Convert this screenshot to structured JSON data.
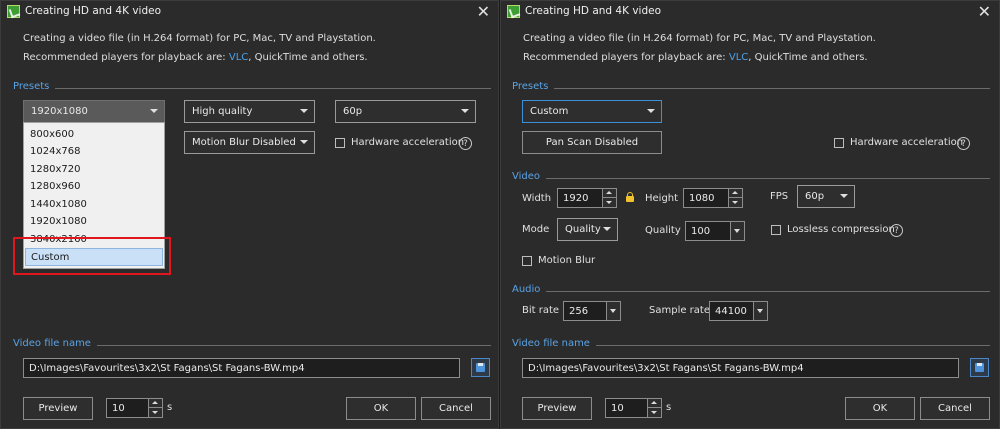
{
  "dialog": {
    "title": "Creating HD and 4K video",
    "desc_line1": "Creating a video file (in H.264 format) for PC, Mac, TV and Playstation.",
    "desc_line2_prefix": "Recommended players for playback are:",
    "desc_link": "VLC",
    "desc_line2_suffix": ", QuickTime and others."
  },
  "left": {
    "presets_label": "Presets",
    "resolution_value": "1920x1080",
    "quality_value": "High quality",
    "fps_value": "60p",
    "motion_blur_value": "Motion Blur Disabled",
    "hw_accel_label": "Hardware acceleration",
    "help_glyph": "?",
    "resolution_options": [
      "800x600",
      "1024x768",
      "1280x720",
      "1280x960",
      "1440x1080",
      "1920x1080",
      "3840x2160",
      "Custom"
    ],
    "video_file_label": "Video file name",
    "video_file_path": "D:\\Images\\Favourites\\3x2\\St Fagans\\St Fagans-BW.mp4",
    "preview_label": "Preview",
    "preview_seconds": "10",
    "seconds_unit": "s",
    "ok_label": "OK",
    "cancel_label": "Cancel"
  },
  "right": {
    "presets_label": "Presets",
    "preset_value": "Custom",
    "pan_scan_label": "Pan  Scan Disabled",
    "hw_accel_label": "Hardware acceleration",
    "help_glyph": "?",
    "video_section": "Video",
    "width_label": "Width",
    "width_value": "1920",
    "height_label": "Height",
    "height_value": "1080",
    "fps_label": "FPS",
    "fps_value": "60p",
    "mode_label": "Mode",
    "mode_value": "Quality",
    "quality_label": "Quality",
    "quality_value": "100",
    "lossless_label": "Lossless compression",
    "motion_blur_label": "Motion Blur",
    "audio_section": "Audio",
    "bitrate_label": "Bit rate",
    "bitrate_value": "256",
    "samplerate_label": "Sample rate",
    "samplerate_value": "44100",
    "video_file_label": "Video file name",
    "video_file_path": "D:\\Images\\Favourites\\3x2\\St Fagans\\St Fagans-BW.mp4",
    "preview_label": "Preview",
    "preview_seconds": "10",
    "seconds_unit": "s",
    "ok_label": "OK",
    "cancel_label": "Cancel"
  },
  "colors": {
    "accent": "#5aa3e6",
    "link": "#4ea2e8",
    "highlight_box": "#e0171e",
    "background": "#2b2b2b"
  }
}
